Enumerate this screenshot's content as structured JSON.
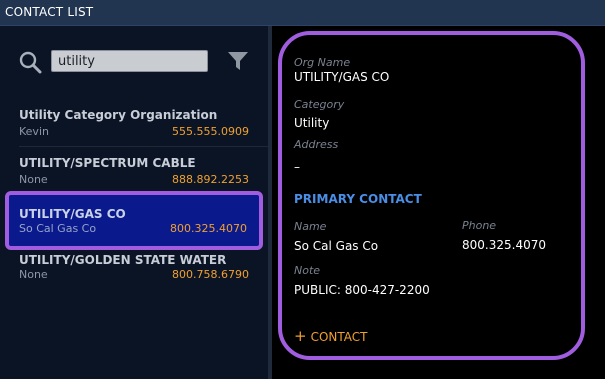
{
  "window": {
    "title": "CONTACT LIST"
  },
  "search": {
    "value": "utility",
    "icon": "search-icon",
    "filter_icon": "filter-icon"
  },
  "list": [
    {
      "name": "Utility Category Organization",
      "sub": "Kevin",
      "phone": "555.555.0909"
    },
    {
      "name": "UTILITY/SPECTRUM CABLE",
      "sub": "None",
      "phone": "888.892.2253"
    },
    {
      "name": "UTILITY/GAS CO",
      "sub": "So Cal Gas Co",
      "phone": "800.325.4070",
      "selected": true
    },
    {
      "name": "UTILITY/GOLDEN STATE WATER",
      "sub": "None",
      "phone": "800.758.6790"
    }
  ],
  "detail": {
    "org_name_label": "Org Name",
    "org_name": "UTILITY/GAS CO",
    "category_label": "Category",
    "category": "Utility",
    "address_label": "Address",
    "address": "–",
    "primary_contact_heading": "PRIMARY CONTACT",
    "name_label": "Name",
    "name": "So Cal Gas Co",
    "phone_label": "Phone",
    "phone": "800.325.4070",
    "note_label": "Note",
    "note": "PUBLIC: 800-427-2200",
    "add_contact_label": "CONTACT"
  },
  "colors": {
    "accent_orange": "#f0a030",
    "highlight_purple": "#a05de0",
    "selected_bg": "#0a1a8c",
    "section_blue": "#4a8ee6"
  }
}
